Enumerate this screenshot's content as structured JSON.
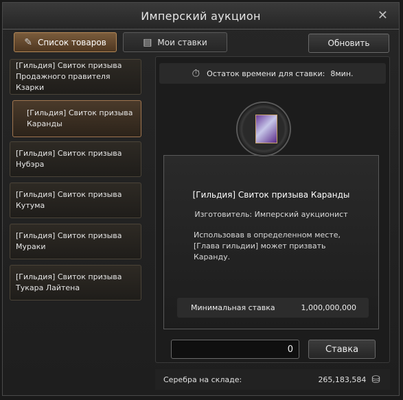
{
  "window": {
    "title": "Имперский аукцион",
    "close_glyph": "✕"
  },
  "tabs": [
    {
      "label": "Список товаров",
      "icon": "list-pen-icon",
      "active": true
    },
    {
      "label": "Мои ставки",
      "icon": "scroll-icon",
      "active": false
    }
  ],
  "refresh_label": "Обновить",
  "items": [
    {
      "label": "[Гильдия] Свиток призыва Продажного правителя Кзарки",
      "selected": false
    },
    {
      "label": "[Гильдия] Свиток призыва Каранды",
      "selected": true
    },
    {
      "label": "[Гильдия] Свиток призыва Нубэра",
      "selected": false
    },
    {
      "label": "[Гильдия] Свиток призыва Кутума",
      "selected": false
    },
    {
      "label": "[Гильдия] Свиток призыва Мураки",
      "selected": false
    },
    {
      "label": "[Гильдия] Свиток призыва Тукара Лайтена",
      "selected": false
    }
  ],
  "timer": {
    "icon": "stopwatch-icon",
    "label": "Остаток времени для ставки:",
    "value": "8мин."
  },
  "detail": {
    "name": "[Гильдия] Свиток призыва Каранды",
    "maker": "Изготовитель: Имперский аукционист",
    "description": "Использовав в определенном месте, [Глава гильдии] может призвать Каранду."
  },
  "min_bid": {
    "label": "Минимальная ставка",
    "value": "1,000,000,000"
  },
  "bid": {
    "value": "0",
    "button_label": "Ставка"
  },
  "footer": {
    "label": "Серебра на складе:",
    "value": "265,183,584",
    "icon": "silver-coins-icon"
  }
}
